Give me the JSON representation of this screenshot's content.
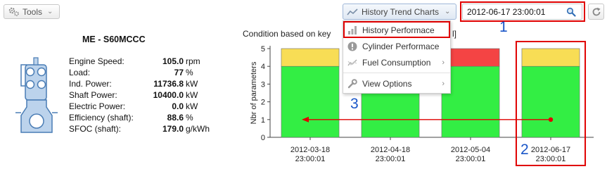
{
  "toolbar": {
    "tools_label": "Tools",
    "history_label": "History Trend Charts",
    "datetime_value": "2012-06-17 23:00:01"
  },
  "menu": {
    "items": [
      {
        "label": "History Performace",
        "icon": "bar-chart-icon"
      },
      {
        "label": "Cylinder Performace",
        "icon": "info-circle-icon"
      },
      {
        "label": "Fuel Consumption",
        "icon": "trend-line-icon"
      },
      {
        "label": "View Options",
        "icon": "wrench-icon"
      }
    ]
  },
  "annotations": {
    "marker_1": "1",
    "marker_2": "2",
    "marker_3": "3",
    "color": "#e00000",
    "marker_color": "#1a56c8"
  },
  "engine": {
    "title": "ME - S60MCCC",
    "rows": [
      {
        "label": "Engine Speed:",
        "value": "105.0",
        "unit": "rpm"
      },
      {
        "label": "Load:",
        "value": "77",
        "unit": "%"
      },
      {
        "label": "Ind. Power:",
        "value": "11736.8",
        "unit": "kW"
      },
      {
        "label": "Shaft Power:",
        "value": "10400.0",
        "unit": "kW"
      },
      {
        "label": "Electric Power:",
        "value": "0.0",
        "unit": "kW"
      },
      {
        "label": "Efficiency (shaft):",
        "value": "88.6",
        "unit": "%"
      },
      {
        "label": "SFOC (shaft):",
        "value": "179.0",
        "unit": "g/kWh"
      }
    ]
  },
  "chart_header": {
    "left": "Condition based on key",
    "right": "l]"
  },
  "chart_data": {
    "type": "bar",
    "stacked": true,
    "categories": [
      "2012-03-18 23:00:01",
      "2012-04-18 23:00:01",
      "2012-05-04 23:00:01",
      "2012-06-17 23:00:01"
    ],
    "category_lines": [
      [
        "2012-03-18",
        "23:00:01"
      ],
      [
        "2012-04-18",
        "23:00:01"
      ],
      [
        "2012-05-04",
        "23:00:01"
      ],
      [
        "2012-06-17",
        "23:00:01"
      ]
    ],
    "series": [
      {
        "name": "",
        "color": "#33ee44",
        "values": [
          4,
          4,
          4,
          4
        ]
      },
      {
        "name": "",
        "color": "#f8dd55",
        "values": [
          1,
          1,
          0,
          1
        ]
      },
      {
        "name": "",
        "color": "#f44444",
        "values": [
          0,
          0,
          1,
          0
        ]
      }
    ],
    "ylabel": "Nbr of parameters",
    "ylim": [
      0,
      5
    ],
    "yticks": [
      0,
      1,
      2,
      3,
      4,
      5
    ],
    "grid": false
  },
  "colors": {
    "accent": "#3a7bd5",
    "highlight_border": "#e00000"
  }
}
